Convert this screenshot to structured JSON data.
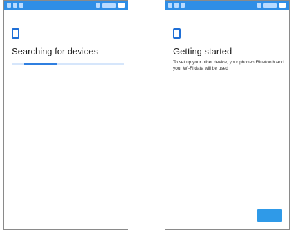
{
  "screens": {
    "searching": {
      "title": "Searching for devices",
      "progress": 0.4,
      "icon": "phone-icon"
    },
    "getting_started": {
      "title": "Getting started",
      "description": "To set up your other device, your phone's Bluetooth and your Wi-Fi data will be used",
      "icon": "phone-icon"
    }
  },
  "colors": {
    "status_bar": "#2f8ee6",
    "accent": "#1f6fd6",
    "progress_track": "#d6e6fb",
    "button": "#2f9ae8"
  }
}
